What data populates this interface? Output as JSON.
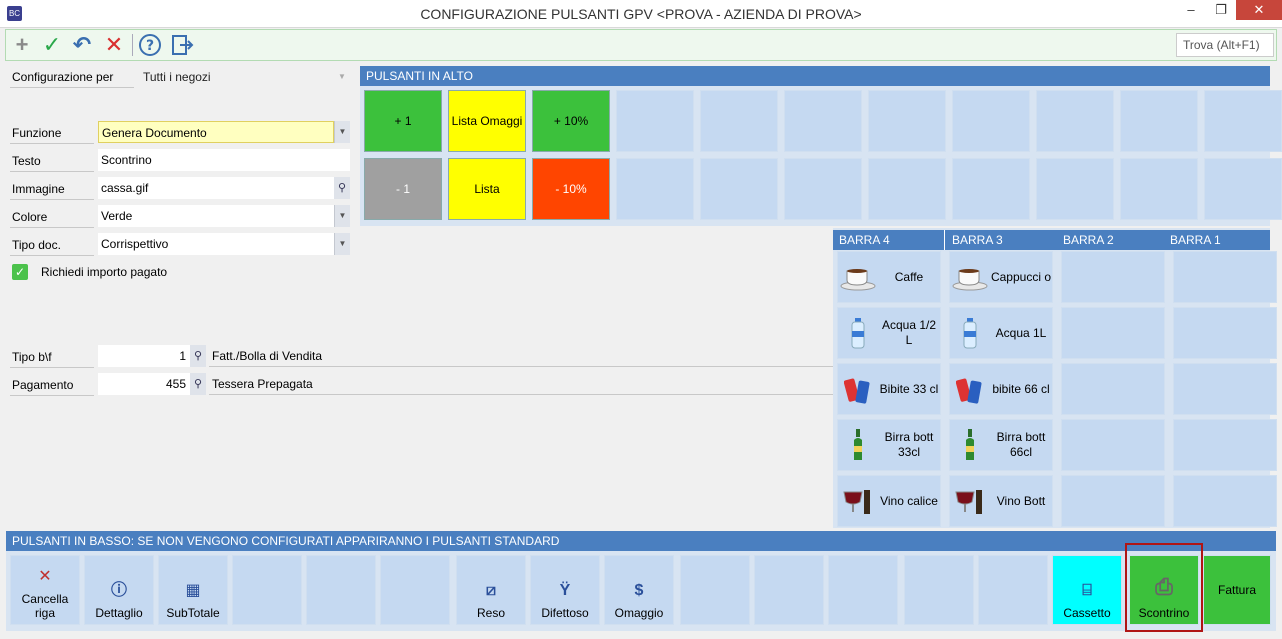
{
  "window": {
    "title": "CONFIGURAZIONE PULSANTI GPV <PROVA - AZIENDA DI PROVA>",
    "minimize": "–",
    "maximize": "❐",
    "close": "✕"
  },
  "toolbar": {
    "search_placeholder": "Trova (Alt+F1)"
  },
  "form": {
    "configurazione_label": "Configurazione per",
    "configurazione_value": "Tutti i negozi",
    "funzione_label": "Funzione",
    "funzione_value": "Genera Documento",
    "testo_label": "Testo",
    "testo_value": "Scontrino",
    "immagine_label": "Immagine",
    "immagine_value": "cassa.gif",
    "colore_label": "Colore",
    "colore_value": "Verde",
    "tipodoc_label": "Tipo doc.",
    "tipodoc_value": "Corrispettivo",
    "richiedi_label": "Richiedi importo pagato",
    "tipobf_label": "Tipo b\\f",
    "tipobf_value": "1",
    "tipobf_desc": "Fatt./Bolla di Vendita",
    "pagamento_label": "Pagamento",
    "pagamento_value": "455",
    "pagamento_desc": "Tessera Prepagata"
  },
  "top_panel": {
    "header": "PULSANTI IN ALTO",
    "row1": [
      {
        "label": "+ 1",
        "color": "#3cc13c"
      },
      {
        "label": "Lista Omaggi",
        "color": "#ffff00"
      },
      {
        "label": "+ 10%",
        "color": "#3cc13c"
      }
    ],
    "row2": [
      {
        "label": "- 1",
        "color": "#a0a0a0"
      },
      {
        "label": "Lista",
        "color": "#ffff00"
      },
      {
        "label": "- 10%",
        "color": "#ff4500"
      }
    ]
  },
  "bars": {
    "headers": [
      "BARRA 4",
      "BARRA 3",
      "BARRA 2",
      "BARRA 1"
    ],
    "barra4": [
      "Caffe",
      "Acqua 1/2 L",
      "Bibite 33 cl",
      "Birra bott 33cl",
      "Vino calice"
    ],
    "barra3": [
      "Cappucci o",
      "Acqua 1L",
      "bibite 66 cl",
      "Birra bott 66cl",
      "Vino Bott"
    ]
  },
  "bottom_panel": {
    "header": "PULSANTI IN BASSO: SE NON VENGONO CONFIGURATI APPARIRANNO I PULSANTI STANDARD",
    "buttons": {
      "cancella": "Cancella riga",
      "dettaglio": "Dettaglio",
      "subtotale": "SubTotale",
      "reso": "Reso",
      "difettoso": "Difettoso",
      "omaggio": "Omaggio",
      "cassetto": "Cassetto",
      "scontrino": "Scontrino",
      "fattura": "Fattura"
    },
    "colors": {
      "cassetto": "#00ffff",
      "scontrino": "#3cc13c",
      "fattura": "#3cc13c",
      "selected_border": "#b01515"
    }
  }
}
